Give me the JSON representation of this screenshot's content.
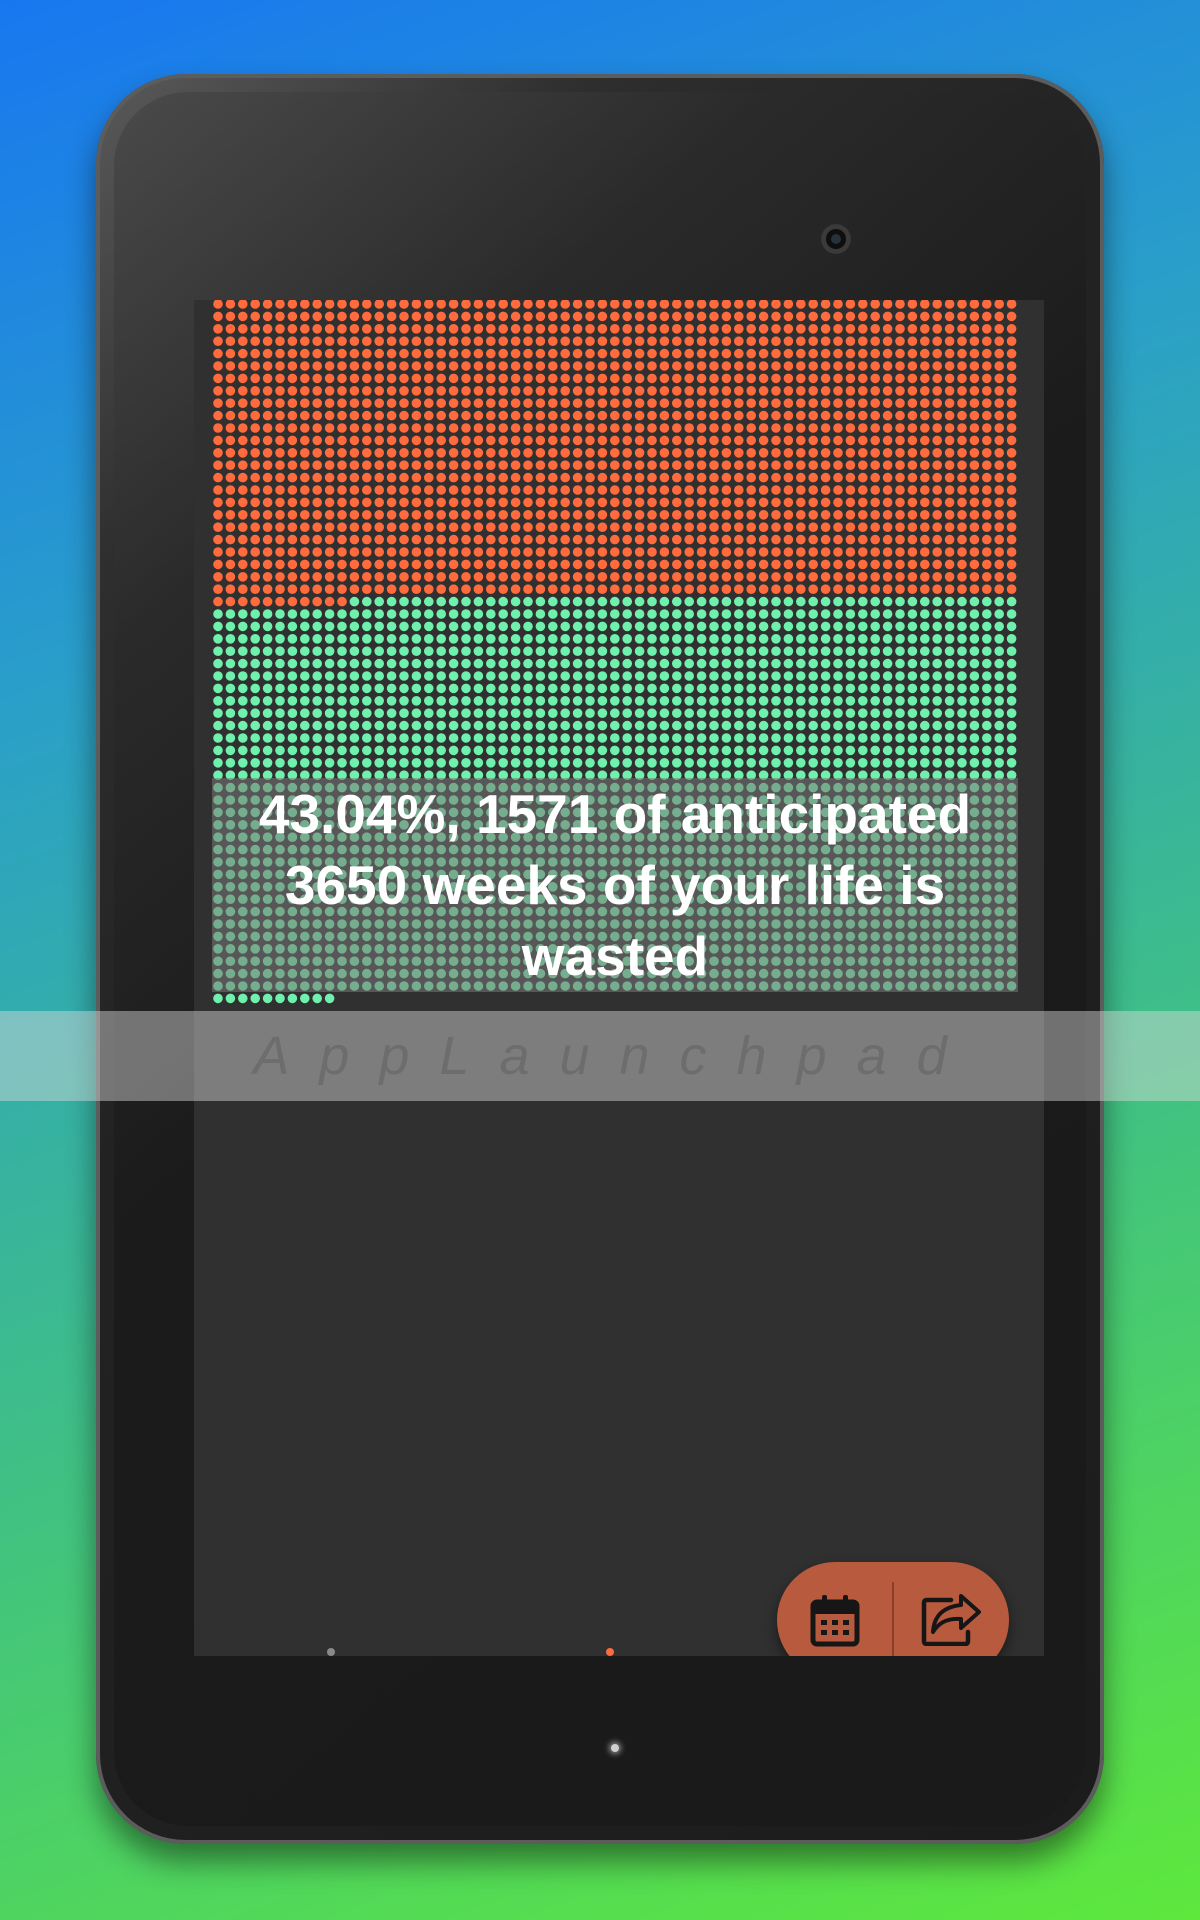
{
  "summary": {
    "percent": "43.04%",
    "text": "43.04%, 1571 of anticipated 3650 weeks of your life is wasted"
  },
  "weeks_grid": {
    "lived_weeks": 1571,
    "total_weeks": 3650,
    "lived_color": "#ff6b3d",
    "remaining_color": "#6ff0ac"
  },
  "fab": {
    "calendar_icon": "calendar-icon",
    "share_icon": "share-icon",
    "color": "#b85a3e"
  },
  "watermark": {
    "text": "AppLaunchpad"
  }
}
